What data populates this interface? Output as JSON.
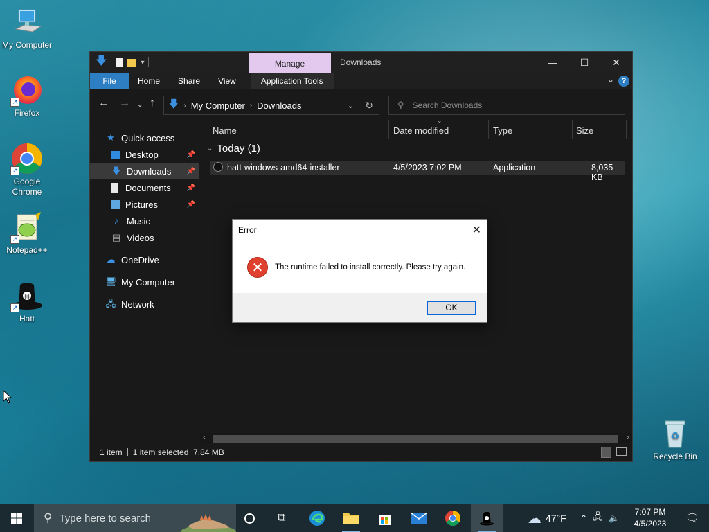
{
  "desktop": {
    "icons": [
      {
        "label": "My Computer"
      },
      {
        "label": "Firefox"
      },
      {
        "label": "Google Chrome"
      },
      {
        "label": "Notepad++"
      },
      {
        "label": "Hatt"
      },
      {
        "label": "Recycle Bin"
      }
    ]
  },
  "explorer": {
    "context_tab": "Manage",
    "title": "Downloads",
    "ribbon_tabs": [
      "File",
      "Home",
      "Share",
      "View",
      "Application Tools"
    ],
    "breadcrumb": [
      "My Computer",
      "Downloads"
    ],
    "search_placeholder": "Search Downloads",
    "nav": {
      "quick_access": "Quick access",
      "items": [
        {
          "label": "Desktop",
          "pinned": true
        },
        {
          "label": "Downloads",
          "pinned": true,
          "selected": true
        },
        {
          "label": "Documents",
          "pinned": true
        },
        {
          "label": "Pictures",
          "pinned": true
        },
        {
          "label": "Music",
          "pinned": false
        },
        {
          "label": "Videos",
          "pinned": false
        }
      ],
      "onedrive": "OneDrive",
      "my_computer": "My Computer",
      "network": "Network"
    },
    "columns": [
      "Name",
      "Date modified",
      "Type",
      "Size"
    ],
    "group": "Today (1)",
    "files": [
      {
        "name": "hatt-windows-amd64-installer",
        "date": "4/5/2023 7:02 PM",
        "type": "Application",
        "size": "8,035 KB"
      }
    ],
    "status": {
      "count": "1 item",
      "selection": "1 item selected  7.84 MB"
    }
  },
  "dialog": {
    "title": "Error",
    "message": "The runtime failed to install correctly. Please try again.",
    "ok_label": "OK"
  },
  "taskbar": {
    "search_placeholder": "Type here to search",
    "weather": "47°F",
    "time": "7:07 PM",
    "date": "4/5/2023"
  },
  "colors": {
    "accent": "#2d7ec2",
    "manage_tab": "#e3c9ee",
    "error_red": "#e0402e"
  }
}
